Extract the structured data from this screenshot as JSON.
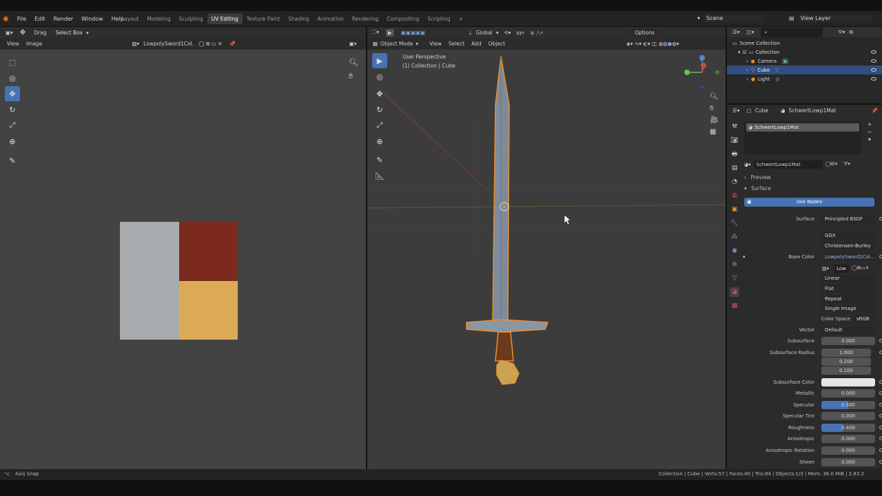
{
  "topbar": {
    "menus": [
      "File",
      "Edit",
      "Render",
      "Window",
      "Help"
    ],
    "workspaces": [
      "Layout",
      "Modeling",
      "Sculpting",
      "UV Editing",
      "Texture Paint",
      "Shading",
      "Animation",
      "Rendering",
      "Compositing",
      "Scripting"
    ],
    "active_workspace": "UV Editing",
    "scene": "Scene",
    "view_layer": "View Layer"
  },
  "uv_editor": {
    "drag_label": "Drag",
    "select_mode": "Select Box",
    "view_menu": "View",
    "image_menu": "Image",
    "image_name": "LowpolySword1Col...",
    "texture_colors": {
      "left": "#a7abae",
      "top_right": "#7c2a1e",
      "bottom_right": "#dcaa57"
    }
  },
  "viewport": {
    "orientation": "Global",
    "options_label": "Options",
    "mode": "Object Mode",
    "menus": [
      "View",
      "Select",
      "Add",
      "Object"
    ],
    "perspective_label": "User Perspective",
    "collection_label": "(1) Collection | Cube"
  },
  "outliner": {
    "root": "Scene Collection",
    "items": [
      {
        "label": "Collection",
        "indent": 1,
        "icon": "collection-icon"
      },
      {
        "label": "Camera",
        "indent": 2,
        "icon": "camera-icon"
      },
      {
        "label": "Cube",
        "indent": 2,
        "icon": "mesh-icon",
        "selected": true
      },
      {
        "label": "Light",
        "indent": 2,
        "icon": "light-icon"
      }
    ]
  },
  "properties": {
    "object_name": "Cube",
    "material_name": "SchwertLowp1Mat",
    "slot_label": "SchwertLowp1Mat",
    "datablock": "SchwertLowp1Mat",
    "preview_label": "Preview",
    "surface_section": "Surface",
    "use_nodes": "Use Nodes",
    "surface_label": "Surface",
    "surface_value": "Principled BSDF",
    "distribution": "GGX",
    "subsurface_method": "Christensen-Burley",
    "base_color_label": "Base Color",
    "base_color_value": "LowpolySword1Col...",
    "image_short": "Low",
    "interpolation": "Linear",
    "projection": "Flat",
    "extension": "Repeat",
    "source": "Single Image",
    "color_space_label": "Color Space",
    "color_space_value": "sRGB",
    "vector_label": "Vector",
    "vector_value": "Default",
    "subsurface_label": "Subsurface",
    "subsurface_value": "0.000",
    "subsurface_radius_label": "Subsurface Radius",
    "subsurface_radius": [
      "1.000",
      "0.200",
      "0.100"
    ],
    "subsurface_color_label": "Subsurface Color",
    "metallic_label": "Metallic",
    "metallic_value": "0.000",
    "specular_label": "Specular",
    "specular_value": "0.500",
    "specular_tint_label": "Specular Tint",
    "specular_tint_value": "0.000",
    "roughness_label": "Roughness",
    "roughness_value": "0.400",
    "anisotropic_label": "Anisotropic",
    "anisotropic_value": "0.000",
    "anisotropic_rotation_label": "Anisotropic Rotation",
    "anisotropic_rotation_value": "0.000",
    "sheen_label": "Sheen",
    "sheen_value": "0.000"
  },
  "status": {
    "left": "Axis Snap",
    "right": "Collection | Cube | Verts:57 | Faces:40 | Tris:84 | Objects:1/3 | Mem: 36.0 MiB | 2.83.2"
  },
  "colors": {
    "accent": "#4772b3",
    "sword_outline": "#e8932f",
    "blade": "#7e8a9a",
    "handle": "#6b3a1c",
    "pommel": "#c9a352"
  }
}
